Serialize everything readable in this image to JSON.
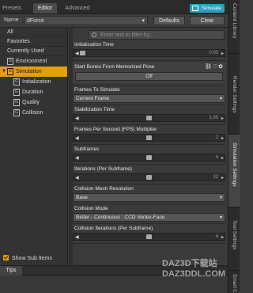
{
  "tabs": [
    "Presets",
    "Editor",
    "Advanced"
  ],
  "active_tab": "Editor",
  "simulate_label": "Simulate",
  "preset": {
    "label": "Name :",
    "value": "dForce",
    "defaults": "Defaults",
    "clear": "Clear"
  },
  "sidebar": {
    "categories": [
      "All",
      "Favorites",
      "Currently Used"
    ],
    "environment": "Environment",
    "simulation": "Simulation",
    "children": [
      "Initialization",
      "Duration",
      "Quality",
      "Collision"
    ],
    "show_sub_items": "Show Sub Items"
  },
  "filter_placeholder": "Enter text to filter by...",
  "props": {
    "init_time": {
      "label": "Initialization Time",
      "value": "0.00"
    },
    "start_bones": {
      "label": "Start Bones From Memorized Pose",
      "button": "Off"
    },
    "frames": {
      "label": "Frames To Simulate",
      "value": "Current Frame"
    },
    "stab_time": {
      "label": "Stabilization Time",
      "value": "1.00"
    },
    "fps": {
      "label": "Frames Per Second (FPS) Multiplier",
      "value": "2"
    },
    "subframes": {
      "label": "Subframes",
      "value": "4"
    },
    "iterations": {
      "label": "Iterations (Per Subframe)",
      "value": "32"
    },
    "mesh_res": {
      "label": "Collision Mesh Resolution",
      "value": "Base"
    },
    "coll_mode": {
      "label": "Collision Mode",
      "value": "Better - Continuous : CCD Vertex-Face"
    },
    "coll_iter": {
      "label": "Collision Iterations (Per Subframe)",
      "value": "4"
    }
  },
  "vertical_tabs": [
    "Content Library",
    "Render Settings",
    "Simulation Settings",
    "Tool Settings",
    "Smart C"
  ],
  "tips_label": "Tips",
  "watermark": [
    "DAZ3D下载站",
    "DAZ3DDL.COM"
  ]
}
